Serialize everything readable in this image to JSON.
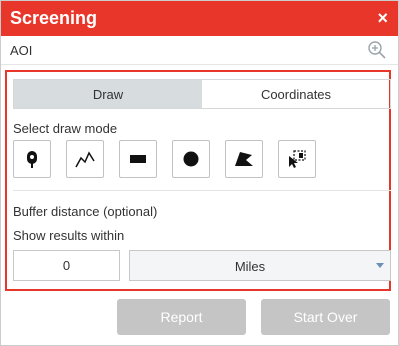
{
  "panel": {
    "title": "Screening",
    "close_icon": "×",
    "aoi_label": "AOI",
    "tabs": [
      "Draw",
      "Coordinates"
    ],
    "active_tab": "Draw",
    "select_draw_mode_label": "Select draw mode",
    "draw_tools": [
      {
        "name": "point-tool-icon"
      },
      {
        "name": "polyline-tool-icon"
      },
      {
        "name": "rectangle-tool-icon"
      },
      {
        "name": "circle-tool-icon"
      },
      {
        "name": "polygon-tool-icon"
      },
      {
        "name": "select-feature-tool-icon"
      }
    ],
    "buffer_label": "Buffer distance (optional)",
    "show_within_label": "Show results within",
    "distance_value": "0",
    "units_value": "Miles",
    "report_label": "Report",
    "start_over_label": "Start Over"
  },
  "colors": {
    "header": "#e8372a",
    "frame": "#e8372a",
    "disabled_button": "#c5c5c5",
    "active_tab": "#d7dcdf"
  }
}
